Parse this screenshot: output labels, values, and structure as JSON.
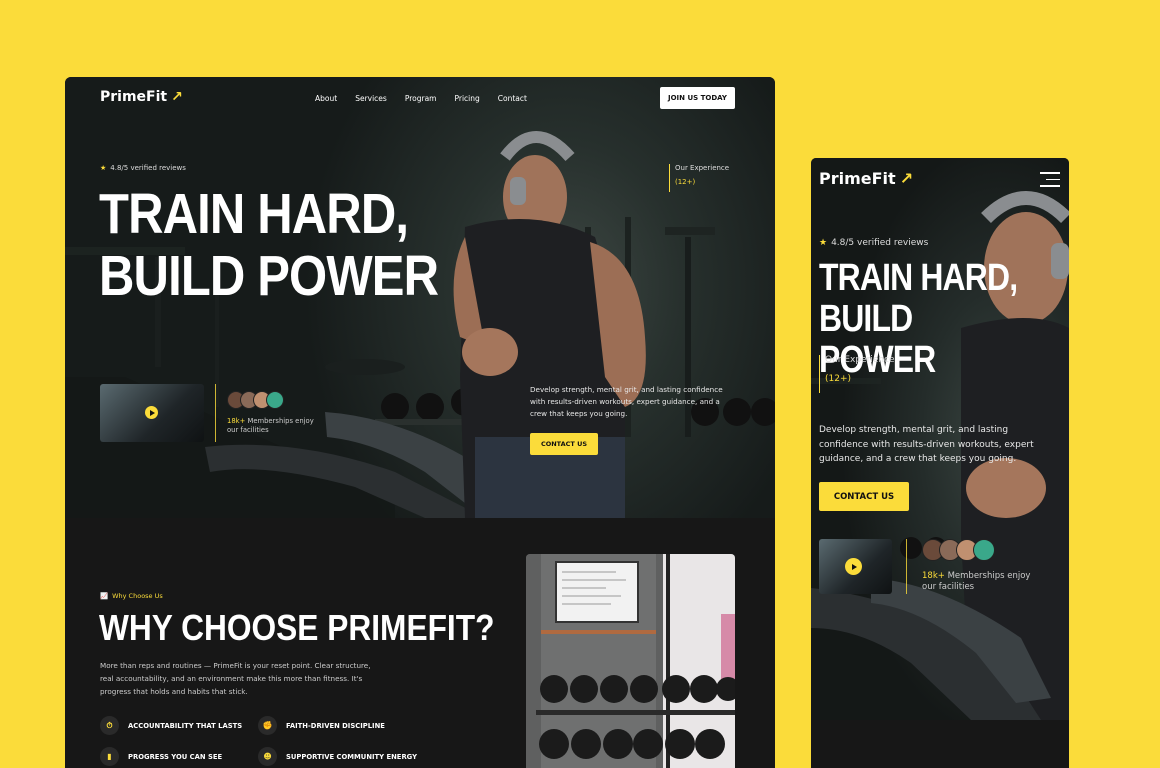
{
  "brand": {
    "name": "PrimeFit",
    "arrow": "↗",
    "accent": "#fbdc3a",
    "background": "#171717"
  },
  "nav": {
    "items": [
      "About",
      "Services",
      "Program",
      "Pricing",
      "Contact"
    ],
    "cta": "JOIN US TODAY"
  },
  "hero": {
    "rating": "4.8/5 verified reviews",
    "rating_icon": "star-icon",
    "headline_line1": "TRAIN HARD,",
    "headline_line2": "BUILD POWER",
    "experience_label": "Our Experience",
    "experience_value": "(12+)",
    "description": "Develop strength, mental grit, and lasting confidence with results-driven workouts, expert guidance, and a crew that keeps you going.",
    "cta": "CONTACT US",
    "members_count": "18k+",
    "members_text": "Memberships enjoy our facilities"
  },
  "why": {
    "eyebrow": "Why Choose Us",
    "eyebrow_icon": "chart-icon",
    "title": "WHY CHOOSE PRIMEFIT?",
    "text": "More than reps and routines — PrimeFit is your reset point. Clear structure, real accountability, and an environment make this more than fitness. It's progress that holds and habits that stick.",
    "features": [
      {
        "label": "ACCOUNTABILITY THAT LASTS",
        "icon": "stopwatch-icon"
      },
      {
        "label": "FAITH-DRIVEN DISCIPLINE",
        "icon": "fist-icon"
      },
      {
        "label": "PROGRESS YOU CAN SEE",
        "icon": "bar-chart-icon"
      },
      {
        "label": "SUPPORTIVE COMMUNITY ENERGY",
        "icon": "group-icon"
      }
    ]
  },
  "mobile": {
    "menu_icon": "hamburger-icon"
  }
}
